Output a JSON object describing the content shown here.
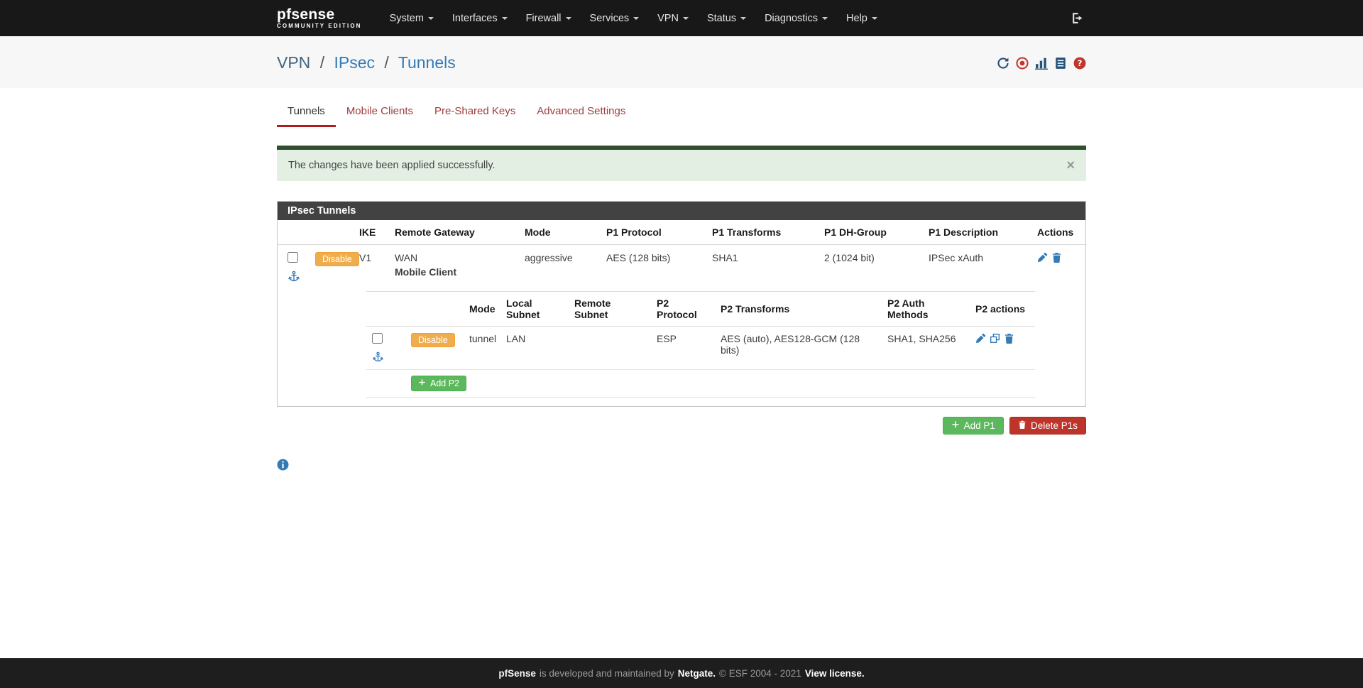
{
  "colors": {
    "accent_blue": "#337ab7",
    "warning_orange": "#f0ad4e",
    "success_green": "#5cb85c",
    "danger_red": "#bd342a",
    "tab_inactive_red": "#9e3c3c",
    "active_tab_underline": "#b01b1b",
    "panel_header_gray": "#424242",
    "navbar_black": "#181818"
  },
  "icons": {
    "logout": "sign-out",
    "refresh": "refresh",
    "status": "dot-circle",
    "chart": "bar-chart",
    "log": "file-text",
    "help": "question-circle",
    "edit": "pencil",
    "copy": "clone",
    "delete": "trash",
    "anchor": "anchor",
    "info": "info-circle",
    "add": "plus",
    "caret": "caret-down"
  },
  "navbar": {
    "logo_text": "pfsense",
    "logo_sub": "COMMUNITY EDITION",
    "items": [
      {
        "label": "System"
      },
      {
        "label": "Interfaces"
      },
      {
        "label": "Firewall"
      },
      {
        "label": "Services"
      },
      {
        "label": "VPN"
      },
      {
        "label": "Status"
      },
      {
        "label": "Diagnostics"
      },
      {
        "label": "Help"
      }
    ]
  },
  "breadcrumb": {
    "root": "VPN",
    "section": "IPsec",
    "page": "Tunnels",
    "separator": "/"
  },
  "tabs": [
    {
      "label": "Tunnels",
      "active": true
    },
    {
      "label": "Mobile Clients",
      "active": false
    },
    {
      "label": "Pre-Shared Keys",
      "active": false
    },
    {
      "label": "Advanced Settings",
      "active": false
    }
  ],
  "alert": {
    "message": "The changes have been applied successfully.",
    "close_label": "×"
  },
  "panel": {
    "title": "IPsec Tunnels",
    "p1_headers": {
      "ike": "IKE",
      "remote_gateway": "Remote Gateway",
      "mode": "Mode",
      "protocol": "P1 Protocol",
      "transforms": "P1 Transforms",
      "dh_group": "P1 DH-Group",
      "description": "P1 Description",
      "actions": "Actions"
    },
    "p1_row": {
      "disable_label": "Disable",
      "ike": "V1",
      "gateway_interface": "WAN",
      "gateway_name": "Mobile Client",
      "mode": "aggressive",
      "protocol": "AES (128 bits)",
      "transforms": "SHA1",
      "dh_group": "2 (1024 bit)",
      "description": "IPSec xAuth"
    },
    "p2_headers": {
      "mode": "Mode",
      "local_subnet": "Local Subnet",
      "remote_subnet": "Remote Subnet",
      "protocol": "P2 Protocol",
      "transforms": "P2 Transforms",
      "auth_methods": "P2 Auth Methods",
      "actions": "P2 actions"
    },
    "p2_row": {
      "disable_label": "Disable",
      "mode": "tunnel",
      "local_subnet": "LAN",
      "remote_subnet": "",
      "protocol": "ESP",
      "transforms": "AES (auto), AES128-GCM (128 bits)",
      "auth_methods": "SHA1, SHA256"
    },
    "add_p2_label": "Add P2"
  },
  "actions": {
    "add_p1_label": "Add P1",
    "delete_p1s_label": "Delete P1s"
  },
  "footer": {
    "brand": "pfSense",
    "text_1": "is developed and maintained by",
    "netgate": "Netgate.",
    "copyright": "© ESF 2004 - 2021",
    "license": "View license."
  }
}
